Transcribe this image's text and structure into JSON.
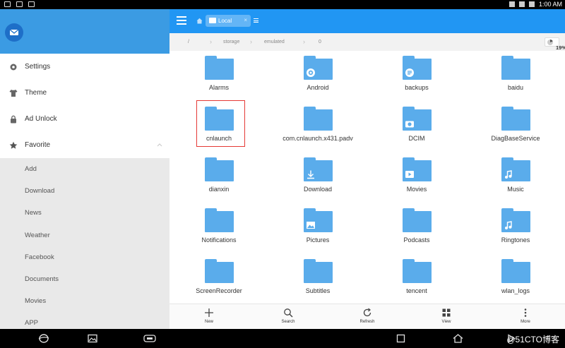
{
  "status_bar": {
    "time": "1:00 AM"
  },
  "drawer": {
    "menu": [
      {
        "label": "Settings",
        "icon": "gear-icon"
      },
      {
        "label": "Theme",
        "icon": "shirt-icon"
      },
      {
        "label": "Ad Unlock",
        "icon": "lock-icon"
      }
    ],
    "favorite": {
      "label": "Favorite",
      "items": [
        "Add",
        "Download",
        "News",
        "Weather",
        "Facebook",
        "Documents",
        "Movies",
        "APP"
      ]
    }
  },
  "header": {
    "tab_label": "Local",
    "tab_close": "×"
  },
  "breadcrumb": {
    "segments": [
      "/",
      "storage",
      "emulated",
      "0"
    ],
    "storage_percent": "19%"
  },
  "folders": [
    {
      "name": "Alarms",
      "badge": null
    },
    {
      "name": "Android",
      "badge": "gear-icon"
    },
    {
      "name": "backups",
      "badge": "backup-icon"
    },
    {
      "name": "baidu",
      "badge": null
    },
    {
      "name": "cnlaunch",
      "badge": null,
      "highlighted": true
    },
    {
      "name": "com.cnlaunch.x431.padv",
      "badge": null
    },
    {
      "name": "DCIM",
      "badge": "camera-icon"
    },
    {
      "name": "DiagBaseService",
      "badge": null
    },
    {
      "name": "dianxin",
      "badge": null
    },
    {
      "name": "Download",
      "badge": "download-icon"
    },
    {
      "name": "Movies",
      "badge": "play-icon"
    },
    {
      "name": "Music",
      "badge": "music-icon"
    },
    {
      "name": "Notifications",
      "badge": null
    },
    {
      "name": "Pictures",
      "badge": "image-icon"
    },
    {
      "name": "Podcasts",
      "badge": null
    },
    {
      "name": "Ringtones",
      "badge": "music-icon"
    },
    {
      "name": "ScreenRecorder",
      "badge": null
    },
    {
      "name": "Subtitles",
      "badge": null
    },
    {
      "name": "tencent",
      "badge": null
    },
    {
      "name": "wlan_logs",
      "badge": null
    }
  ],
  "toolbar": {
    "new_label": "New",
    "search_label": "Search",
    "refresh_label": "Refresh",
    "view_label": "View",
    "more_label": "More"
  },
  "watermark": "@51CTO博客",
  "colors": {
    "accent": "#2196f3",
    "folder": "#5aaceb",
    "drawer_header": "#3b9be3",
    "highlight": "#e53935"
  }
}
